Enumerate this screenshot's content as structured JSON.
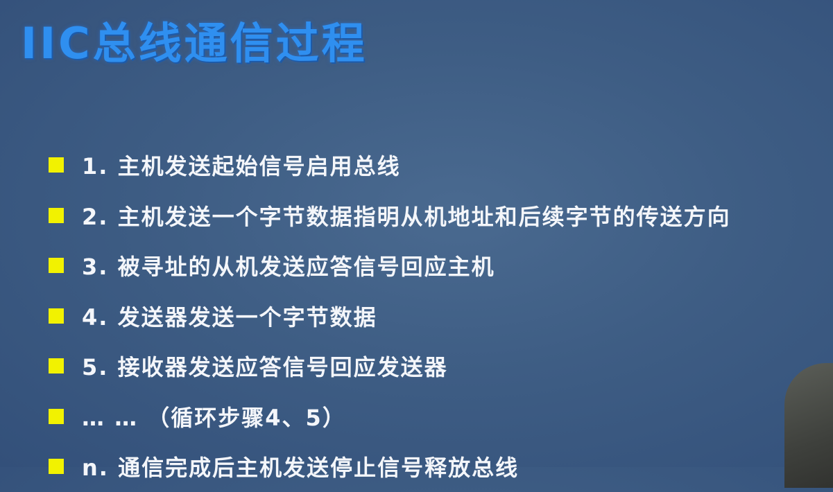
{
  "slide": {
    "title": "IIC总线通信过程",
    "items": [
      "1. 主机发送起始信号启用总线",
      "2. 主机发送一个字节数据指明从机地址和后续字节的传送方向",
      "3. 被寻址的从机发送应答信号回应主机",
      "4. 发送器发送一个字节数据",
      "5. 接收器发送应答信号回应发送器",
      "… …  （循环步骤4、5）",
      "n. 通信完成后主机发送停止信号释放总线"
    ]
  },
  "colors": {
    "background": "#3e5d84",
    "title": "#2f8ff0",
    "bullet": "#f2f200",
    "text": "#f4f6fa"
  }
}
